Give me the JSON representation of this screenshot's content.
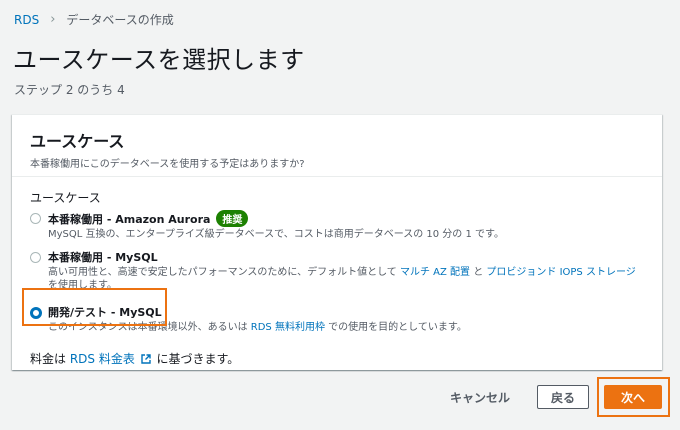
{
  "breadcrumb": {
    "root": "RDS",
    "current": "データベースの作成"
  },
  "page": {
    "title": "ユースケースを選択します",
    "step": "ステップ 2 のうち 4"
  },
  "panel": {
    "title": "ユースケース",
    "description": "本番稼働用にこのデータベースを使用する予定はありますか?",
    "field_label": "ユースケース",
    "options": [
      {
        "title": "本番稼働用 - Amazon Aurora",
        "badge": "推奨",
        "description": "MySQL 互換の、エンタープライズ級データベースで、コストは商用データベースの 10 分の 1 です。",
        "selected": false
      },
      {
        "title": "本番稼働用 - MySQL",
        "desc_part1": "高い可用性と、高速で安定したパフォーマンスのために、デフォルト値として ",
        "link1": "マルチ AZ 配置",
        "desc_part2": " と ",
        "link2": "プロビジョンド IOPS ストレージ",
        "desc_part3": " を使用します。",
        "selected": false
      },
      {
        "title": "開発/テスト - MySQL",
        "desc_part1": "このインスタンスは本番環境以外、あるいは ",
        "link1": "RDS 無料利用枠",
        "desc_part2": " での使用を目的としています。",
        "selected": true
      }
    ],
    "pricing": {
      "prefix": "料金は ",
      "link": "RDS 料金表",
      "suffix": " に基づきます。"
    }
  },
  "footer": {
    "cancel_label": "キャンセル",
    "back_label": "戻る",
    "next_label": "次へ"
  },
  "colors": {
    "accent": "#ec7211",
    "link": "#0073bb",
    "badge": "#1d8102"
  }
}
